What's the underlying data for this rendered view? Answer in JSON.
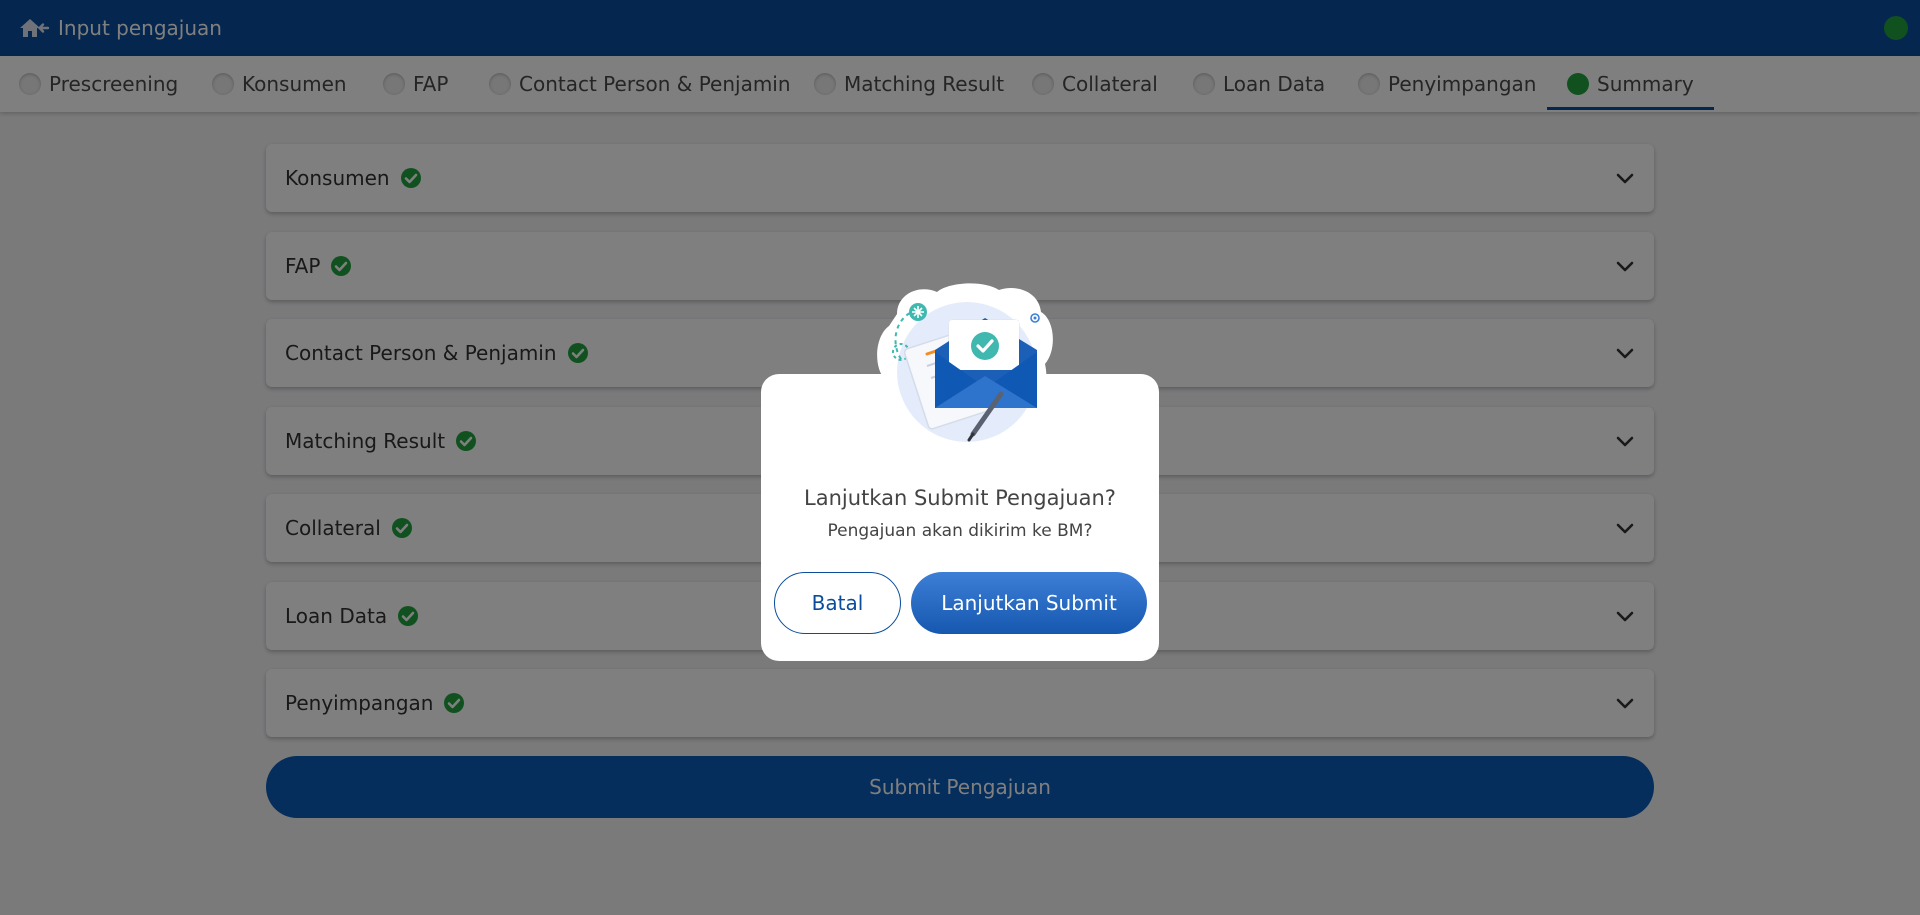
{
  "header": {
    "title": "Input pengajuan"
  },
  "tabs": [
    {
      "label": "Prescreening",
      "active": false
    },
    {
      "label": "Konsumen",
      "active": false
    },
    {
      "label": "FAP",
      "active": false
    },
    {
      "label": "Contact Person & Penjamin",
      "active": false
    },
    {
      "label": "Matching Result",
      "active": false
    },
    {
      "label": "Collateral",
      "active": false
    },
    {
      "label": "Loan Data",
      "active": false
    },
    {
      "label": "Penyimpangan",
      "active": false
    },
    {
      "label": "Summary",
      "active": true
    }
  ],
  "sections": [
    {
      "label": "Konsumen",
      "status": "complete"
    },
    {
      "label": "FAP",
      "status": "complete"
    },
    {
      "label": "Contact Person & Penjamin",
      "status": "complete"
    },
    {
      "label": "Matching Result",
      "status": "complete"
    },
    {
      "label": "Collateral",
      "status": "complete"
    },
    {
      "label": "Loan Data",
      "status": "complete"
    },
    {
      "label": "Penyimpangan",
      "status": "complete"
    }
  ],
  "submit_label": "Submit Pengajuan",
  "modal": {
    "title": "Lanjutkan Submit Pengajuan?",
    "subtitle": "Pengajuan akan dikirim ke BM?",
    "cancel_label": "Batal",
    "confirm_label": "Lanjutkan Submit"
  },
  "colors": {
    "brand": "#0a4d9c",
    "success": "#22a33f",
    "overlay": "rgba(0,0,0,0.5)"
  },
  "icons": {
    "back": "home-back-icon",
    "check": "check-circle-icon",
    "chevron": "chevron-down-icon",
    "illustration": "mail-envelope-check-illustration"
  }
}
